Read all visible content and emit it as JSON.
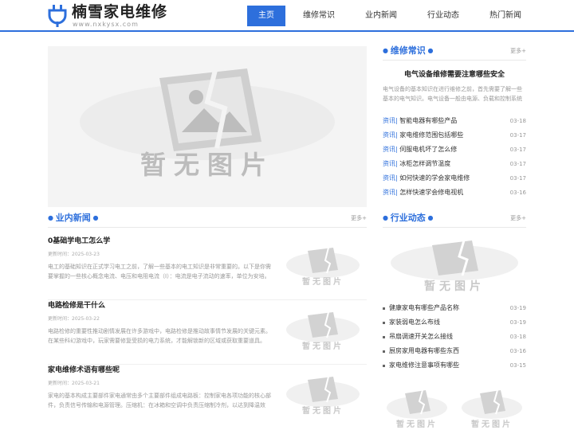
{
  "site": {
    "logo_title": "楠雪家电维修",
    "logo_sub": "www.nxkysx.com",
    "brand_color": "#2d6fdc"
  },
  "nav": {
    "items": [
      "主页",
      "维修常识",
      "业内新闻",
      "行业动态",
      "热门新闻"
    ],
    "active_index": 0
  },
  "placeholder_text": "暂无图片",
  "repair": {
    "title": "维修常识",
    "more": "更多+",
    "featured_title": "电气设备维修需要注意哪些安全",
    "featured_desc": "电气设备的基本知识在进行维修之前，首先需要了解一些基本的电气知识。电气设备一般由电源、负载和控制系统组成。",
    "tag": "资讯",
    "items": [
      {
        "title": "智能电器有哪些产品",
        "date": "03-18"
      },
      {
        "title": "家电维修范围包括哪些",
        "date": "03-17"
      },
      {
        "title": "伺服电机坏了怎么修",
        "date": "03-17"
      },
      {
        "title": "冰柜怎样调节温度",
        "date": "03-17"
      },
      {
        "title": "如何快速的学会家电维修",
        "date": "03-17"
      },
      {
        "title": "怎样快速学会修电视机",
        "date": "03-16"
      }
    ]
  },
  "news": {
    "title": "业内新闻",
    "more": "更多+",
    "meta_label": "更新时间：",
    "items": [
      {
        "title": "0基础学电工怎么学",
        "date": "2025-03-23",
        "desc": "电工的基础知识在正式学习电工之前，了解一些基本的电工知识是非常重要的。以下是你需要掌握的一些核心概念电流、电压和电阻电流（I）：电流是电子流动的速率，单位为安培。"
      },
      {
        "title": "电路检修是干什么",
        "date": "2025-03-22",
        "desc": "电路检修的重要性推动剧情发展在许多游戏中，电路检修是推动故事情节发展的关键元素。在某些科幻游戏中，玩家需要修复受损的电力系统，才能解锁新的区域或获取重要道具。"
      },
      {
        "title": "家电维修术语有哪些呢",
        "date": "2025-03-21",
        "desc": "家电的基本构成主要部件家电通常由多个主要部件组成电路板：控制家电各项功能的核心部件，负责信号传输和电源管理。压缩机：在冰箱和空调中负责压缩制冷剂，以达到降温效果。"
      }
    ]
  },
  "industry": {
    "title": "行业动态",
    "more": "更多+",
    "items": [
      {
        "title": "健康家电有哪些产品名称",
        "date": "03-19"
      },
      {
        "title": "家装弱电怎么布线",
        "date": "03-19"
      },
      {
        "title": "吊扇调速开关怎么接线",
        "date": "03-18"
      },
      {
        "title": "厨房家用电器有哪些东西",
        "date": "03-16"
      },
      {
        "title": "家电维修注意事项有哪些",
        "date": "03-15"
      }
    ]
  }
}
